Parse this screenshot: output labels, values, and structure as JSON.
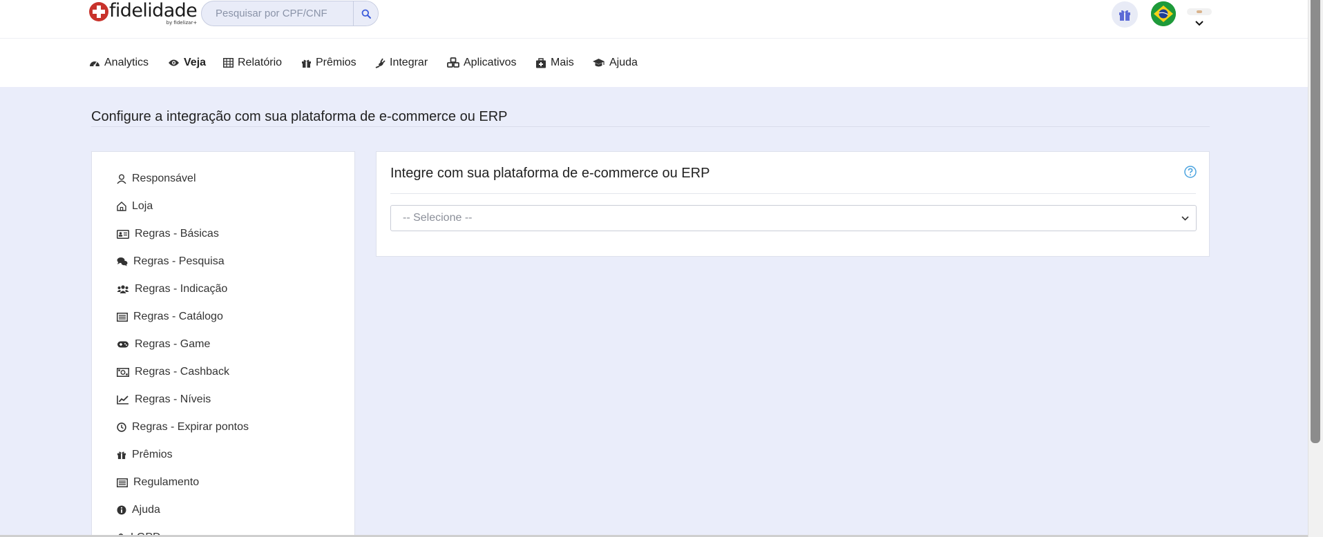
{
  "brand": {
    "name": "fidelidade",
    "sub": "by fidelizar+"
  },
  "search": {
    "placeholder": "Pesquisar por CPF/CNF",
    "value": ""
  },
  "header": {
    "gift_icon": "gift-icon",
    "flag_icon": "brazil-flag-icon",
    "menu_icon": "chevron-down-icon"
  },
  "nav": {
    "items": [
      {
        "label": "Analytics",
        "icon": "dashboard-icon"
      },
      {
        "label": "Veja",
        "icon": "eye-icon",
        "active": true
      },
      {
        "label": "Relatório",
        "icon": "table-icon"
      },
      {
        "label": "Prêmios",
        "icon": "gift-icon"
      },
      {
        "label": "Integrar",
        "icon": "plug-icon"
      },
      {
        "label": "Aplicativos",
        "icon": "cubes-icon"
      },
      {
        "label": "Mais",
        "icon": "medkit-icon"
      },
      {
        "label": "Ajuda",
        "icon": "graduation-cap-icon"
      }
    ]
  },
  "page": {
    "title": "Configure a integração com sua plataforma de e-commerce ou ERP"
  },
  "sidebar": {
    "items": [
      {
        "label": "Responsável",
        "icon": "user-icon"
      },
      {
        "label": "Loja",
        "icon": "home-icon"
      },
      {
        "label": "Regras - Básicas",
        "icon": "id-card-icon"
      },
      {
        "label": "Regras - Pesquisa",
        "icon": "comments-icon"
      },
      {
        "label": "Regras - Indicação",
        "icon": "users-icon"
      },
      {
        "label": "Regras - Catálogo",
        "icon": "list-icon"
      },
      {
        "label": "Regras - Game",
        "icon": "gamepad-icon"
      },
      {
        "label": "Regras - Cashback",
        "icon": "money-bill-icon"
      },
      {
        "label": "Regras - Níveis",
        "icon": "line-chart-icon"
      },
      {
        "label": "Regras - Expirar pontos",
        "icon": "clock-icon"
      },
      {
        "label": "Prêmios",
        "icon": "gift-icon"
      },
      {
        "label": "Regulamento",
        "icon": "list-icon"
      },
      {
        "label": "Ajuda",
        "icon": "info-circle-icon"
      },
      {
        "label": "LGPD",
        "icon": "lock-icon"
      }
    ]
  },
  "card": {
    "title": "Integre com sua plataforma de e-commerce ou ERP",
    "help_icon": "question-circle-icon",
    "select": {
      "selected": "-- Selecione --"
    }
  },
  "colors": {
    "accent": "#3b5bdb",
    "background": "#eaedfa",
    "logo_red": "#c8322b",
    "help_blue": "#4aa3df"
  }
}
